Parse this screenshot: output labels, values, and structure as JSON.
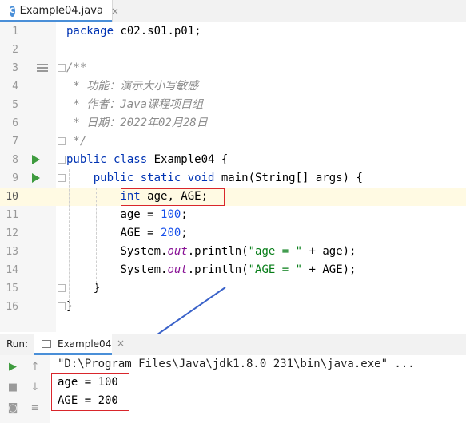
{
  "editor_tab": {
    "icon_letter": "C",
    "label": "Example04.java",
    "close": "×"
  },
  "code_lines": [
    {
      "n": "1"
    },
    {
      "n": "2"
    },
    {
      "n": "3"
    },
    {
      "n": "4"
    },
    {
      "n": "5"
    },
    {
      "n": "6"
    },
    {
      "n": "7"
    },
    {
      "n": "8"
    },
    {
      "n": "9"
    },
    {
      "n": "10"
    },
    {
      "n": "11"
    },
    {
      "n": "12"
    },
    {
      "n": "13"
    },
    {
      "n": "14"
    },
    {
      "n": "15"
    },
    {
      "n": "16"
    }
  ],
  "code": {
    "l1_kw": "package",
    "l1_rest": " c02.s01.p01;",
    "l3": "/**",
    "l4": " * 功能：演示大小写敏感",
    "l5": " * 作者：Java课程项目组",
    "l6": " * 日期：2022年02月28日",
    "l7": " */",
    "l8_kw": "public class",
    "l8_rest": " Example04 {",
    "l9_indent": "    ",
    "l9_kw": "public static void",
    "l9_rest": " main(String[] args) {",
    "l10_indent": "        ",
    "l10_kw": "int",
    "l10_rest": " age, AGE;",
    "l11_indent": "        ",
    "l11_a": "age = ",
    "l11_num": "100",
    "l11_b": ";",
    "l12_indent": "        ",
    "l12_a": "AGE = ",
    "l12_num": "200",
    "l12_b": ";",
    "l13_indent": "        ",
    "l13_a": "System.",
    "l13_fld": "out",
    "l13_b": ".println(",
    "l13_str": "\"age = \"",
    "l13_c": " + age);",
    "l14_indent": "        ",
    "l14_a": "System.",
    "l14_fld": "out",
    "l14_b": ".println(",
    "l14_str": "\"AGE = \"",
    "l14_c": " + AGE);",
    "l15": "    }",
    "l16": "}"
  },
  "run_panel": {
    "label": "Run:",
    "tab_label": "Example04",
    "tab_close": "×",
    "command": "\"D:\\Program Files\\Java\\jdk1.8.0_231\\bin\\java.exe\" ...",
    "output": [
      "age = 100",
      "AGE = 200"
    ],
    "icons": [
      "rerun-icon",
      "scroll-up-icon",
      "stop-icon",
      "scroll-down-icon",
      "camera-icon",
      "wrap-icon"
    ]
  },
  "colors": {
    "keyword": "#0033b3",
    "comment": "#8c8c8c",
    "string": "#067d17",
    "number": "#1750eb",
    "highlight_box": "#d9262b",
    "arrow": "#3a62c9"
  }
}
